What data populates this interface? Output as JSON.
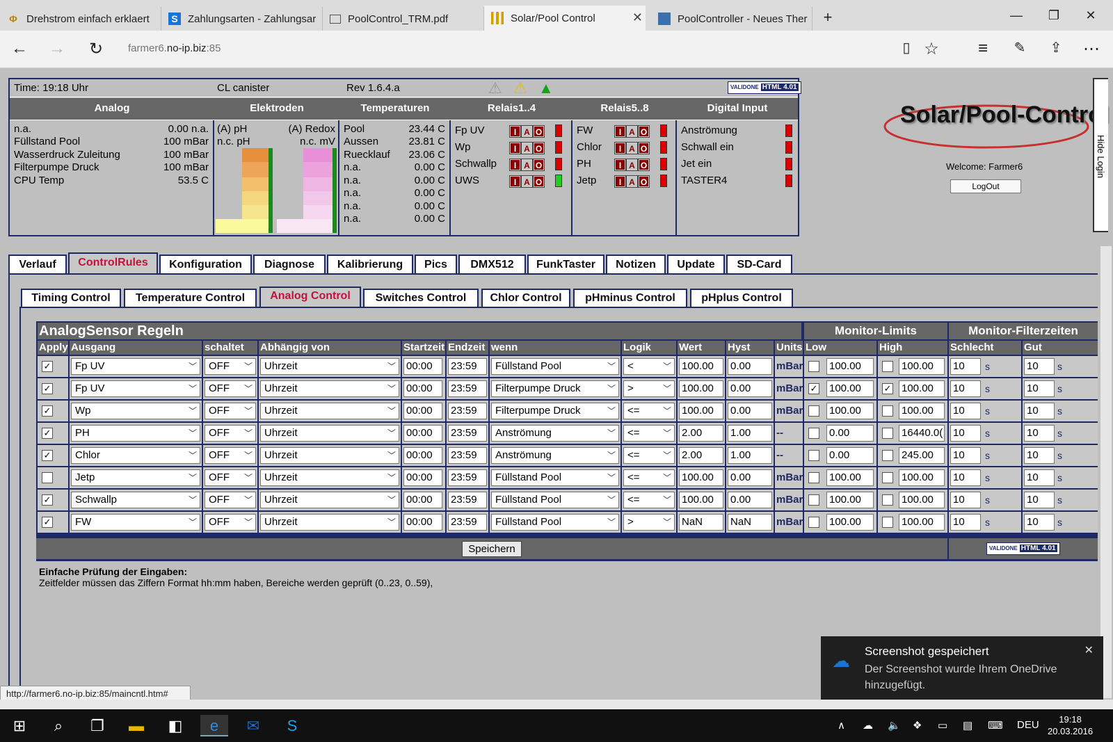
{
  "browser": {
    "tabs": [
      {
        "title": "Drehstrom einfach erklaert",
        "icon": "phi-icon"
      },
      {
        "title": "Zahlungsarten - Zahlungsar",
        "icon": "s-logo-icon"
      },
      {
        "title": "PoolControl_TRM.pdf",
        "icon": "pdf-icon"
      },
      {
        "title": "Solar/Pool Control",
        "icon": "bars-icon"
      },
      {
        "title": "PoolController - Neues Ther",
        "icon": "site-icon"
      }
    ],
    "url_prefix": "farmer6.",
    "url_host": "no-ip.biz",
    "url_port": ":85"
  },
  "header": {
    "time": "Time: 19:18 Uhr",
    "cl": "CL canister",
    "rev": "Rev 1.6.4.a",
    "groups": [
      "Analog",
      "Elektroden",
      "Temperaturen",
      "Relais1..4",
      "Relais5..8",
      "Digital Input"
    ],
    "analog": [
      {
        "name": "n.a.",
        "value": "0.00 n.a."
      },
      {
        "name": "Füllstand Pool",
        "value": "100 mBar"
      },
      {
        "name": "Wasserdruck Zuleitung",
        "value": "100 mBar"
      },
      {
        "name": "Filterpumpe Druck",
        "value": "100 mBar"
      },
      {
        "name": "CPU Temp",
        "value": "53.5 C"
      }
    ],
    "elektroden": {
      "ph_label": "(A) pH",
      "redox_label": "(A) Redox",
      "ph_value": "n.c. pH",
      "redox_value": "n.c. mV"
    },
    "temps": [
      {
        "name": "Pool",
        "value": "23.44 C"
      },
      {
        "name": "Aussen",
        "value": "23.81 C"
      },
      {
        "name": "Ruecklauf",
        "value": "23.06 C"
      },
      {
        "name": "n.a.",
        "value": "0.00 C"
      },
      {
        "name": "n.a.",
        "value": "0.00 C"
      },
      {
        "name": "n.a.",
        "value": "0.00 C"
      },
      {
        "name": "n.a.",
        "value": "0.00 C"
      },
      {
        "name": "n.a.",
        "value": "0.00 C"
      }
    ],
    "relais1": [
      {
        "name": "Fp UV",
        "state": "red"
      },
      {
        "name": "Wp",
        "state": "red"
      },
      {
        "name": "Schwallp",
        "state": "red"
      },
      {
        "name": "UWS",
        "state": "green"
      }
    ],
    "relais2": [
      {
        "name": "FW",
        "state": "red"
      },
      {
        "name": "Chlor",
        "state": "red"
      },
      {
        "name": "PH",
        "state": "red"
      },
      {
        "name": "Jetp",
        "state": "red"
      }
    ],
    "relay_buttons": [
      "I",
      "A",
      "O"
    ],
    "digital": [
      "Anströmung",
      "Schwall ein",
      "Jet ein",
      "TASTER4"
    ],
    "validator": "HTML 4.01",
    "validator_prefix": "VALIDONE"
  },
  "logo": "Solar/Pool-Control",
  "welcome": "Welcome:  Farmer6",
  "logout": "LogOut",
  "hide_login": "Hide Login",
  "main_tabs": [
    "Verlauf",
    "ControlRules",
    "Konfiguration",
    "Diagnose",
    "Kalibrierung",
    "Pics",
    "DMX512",
    "FunkTaster",
    "Notizen",
    "Update",
    "SD-Card"
  ],
  "sub_tabs": [
    "Timing Control",
    "Temperature Control",
    "Analog Control",
    "Switches Control",
    "Chlor Control",
    "pHminus Control",
    "pHplus Control"
  ],
  "grid": {
    "title": "AnalogSensor Regeln",
    "monitor_limits": "Monitor-Limits",
    "monitor_filter": "Monitor-Filterzeiten",
    "columns": [
      "Apply",
      "Ausgang",
      "schaltet",
      "Abhängig von",
      "Startzeit",
      "Endzeit",
      "wenn",
      "Logik",
      "Wert",
      "Hyst",
      "Units",
      "Low",
      "High",
      "Schlecht",
      "Gut"
    ],
    "sec_unit": "s",
    "rows": [
      {
        "apply": true,
        "out": "Fp UV",
        "sw": "OFF",
        "dep": "Uhrzeit",
        "start": "00:00",
        "end": "23:59",
        "when": "Füllstand Pool",
        "logic": "<",
        "wert": "100.00",
        "hyst": "0.00",
        "unit": "mBar",
        "low_cb": false,
        "low": "100.00",
        "high_cb": false,
        "high": "100.00",
        "bad": "10",
        "good": "10"
      },
      {
        "apply": true,
        "out": "Fp UV",
        "sw": "OFF",
        "dep": "Uhrzeit",
        "start": "00:00",
        "end": "23:59",
        "when": "Filterpumpe Druck",
        "logic": ">",
        "wert": "100.00",
        "hyst": "0.00",
        "unit": "mBar",
        "low_cb": true,
        "low": "100.00",
        "high_cb": true,
        "high": "100.00",
        "bad": "10",
        "good": "10"
      },
      {
        "apply": true,
        "out": "Wp",
        "sw": "OFF",
        "dep": "Uhrzeit",
        "start": "00:00",
        "end": "23:59",
        "when": "Filterpumpe Druck",
        "logic": "<=",
        "wert": "100.00",
        "hyst": "0.00",
        "unit": "mBar",
        "low_cb": false,
        "low": "100.00",
        "high_cb": false,
        "high": "100.00",
        "bad": "10",
        "good": "10"
      },
      {
        "apply": true,
        "out": "PH",
        "sw": "OFF",
        "dep": "Uhrzeit",
        "start": "00:00",
        "end": "23:59",
        "when": "Anströmung",
        "logic": "<=",
        "wert": "2.00",
        "hyst": "1.00",
        "unit": "--",
        "low_cb": false,
        "low": "0.00",
        "high_cb": false,
        "high": "16440.0(",
        "bad": "10",
        "good": "10"
      },
      {
        "apply": true,
        "out": "Chlor",
        "sw": "OFF",
        "dep": "Uhrzeit",
        "start": "00:00",
        "end": "23:59",
        "when": "Anströmung",
        "logic": "<=",
        "wert": "2.00",
        "hyst": "1.00",
        "unit": "--",
        "low_cb": false,
        "low": "0.00",
        "high_cb": false,
        "high": "245.00",
        "bad": "10",
        "good": "10"
      },
      {
        "apply": false,
        "out": "Jetp",
        "sw": "OFF",
        "dep": "Uhrzeit",
        "start": "00:00",
        "end": "23:59",
        "when": "Füllstand Pool",
        "logic": "<=",
        "wert": "100.00",
        "hyst": "0.00",
        "unit": "mBar",
        "low_cb": false,
        "low": "100.00",
        "high_cb": false,
        "high": "100.00",
        "bad": "10",
        "good": "10"
      },
      {
        "apply": true,
        "out": "Schwallp",
        "sw": "OFF",
        "dep": "Uhrzeit",
        "start": "00:00",
        "end": "23:59",
        "when": "Füllstand Pool",
        "logic": "<=",
        "wert": "100.00",
        "hyst": "0.00",
        "unit": "mBar",
        "low_cb": false,
        "low": "100.00",
        "high_cb": false,
        "high": "100.00",
        "bad": "10",
        "good": "10"
      },
      {
        "apply": true,
        "out": "FW",
        "sw": "OFF",
        "dep": "Uhrzeit",
        "start": "00:00",
        "end": "23:59",
        "when": "Füllstand Pool",
        "logic": ">",
        "wert": "NaN",
        "hyst": "NaN",
        "unit": "mBar",
        "low_cb": false,
        "low": "100.00",
        "high_cb": false,
        "high": "100.00",
        "bad": "10",
        "good": "10"
      }
    ],
    "save": "Speichern"
  },
  "notes": {
    "title": "Einfache Prüfung der Eingaben:",
    "text": "Zeitfelder müssen das Ziffern Format hh:mm haben, Bereiche werden geprüft (0..23, 0..59),"
  },
  "status_url": "http://farmer6.no-ip.biz:85/maincntl.htm#",
  "toast": {
    "title": "Screenshot gespeichert",
    "body": "Der Screenshot wurde Ihrem OneDrive hinzugefügt."
  },
  "taskbar": {
    "lang": "DEU",
    "time": "19:18",
    "date": "20.03.2016"
  },
  "colors": {
    "navy": "#1e2a66",
    "selected_tab": "#c0143c",
    "relay_red": "#8b0000",
    "led_red": "#dd0000",
    "led_green": "#22cc22"
  }
}
